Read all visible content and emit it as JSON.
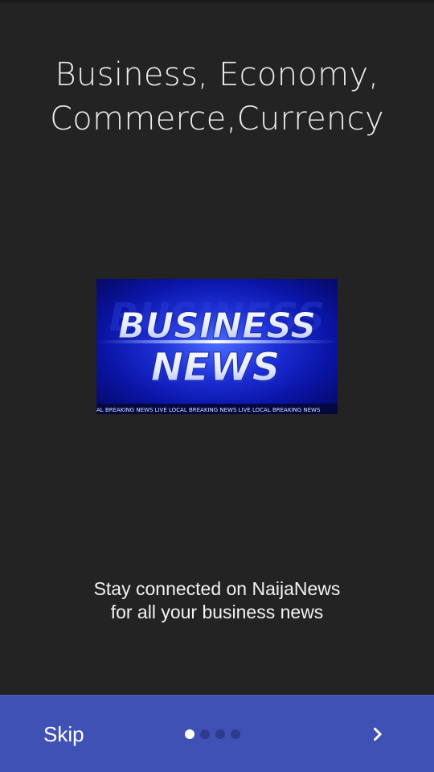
{
  "title": {
    "line1": "Business, Economy,",
    "line2": "Commerce,Currency"
  },
  "hero": {
    "line1": "BUSINESS",
    "line2": "NEWS",
    "ticker": "AL BREAKING NEWS   LIVE LOCAL BREAKING NEWS   LIVE LOCAL BREAKING NEWS"
  },
  "message": {
    "line1": "Stay connected on NaijaNews",
    "line2": "for all your business news"
  },
  "bottom_bar": {
    "skip_label": "Skip",
    "page_count": 4,
    "active_page": 1,
    "next_icon": "chevron-right-icon"
  },
  "colors": {
    "background": "#232323",
    "bottom_bar": "#3f51b5",
    "dot_active": "#ffffff",
    "dot_inactive": "#2f3a8a"
  }
}
